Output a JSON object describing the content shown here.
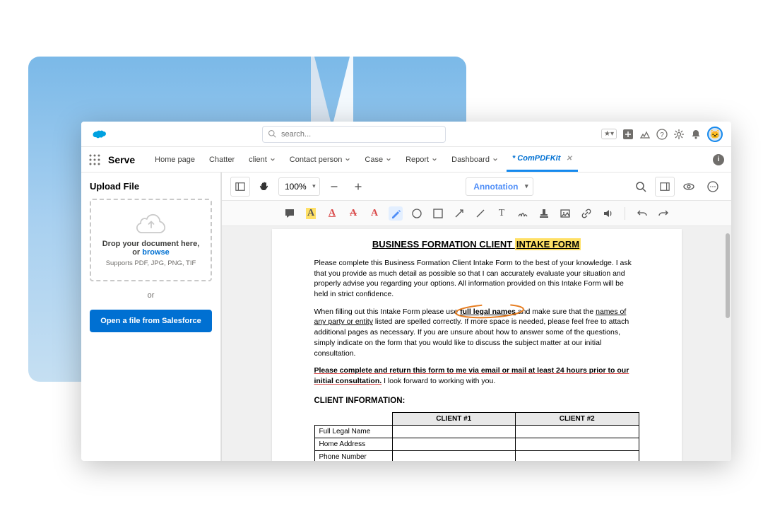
{
  "header": {
    "search_placeholder": "search...",
    "star_combo": "★▾"
  },
  "nav": {
    "app_name": "Serve",
    "tabs": [
      {
        "label": "Home page",
        "has_menu": false
      },
      {
        "label": "Chatter",
        "has_menu": false
      },
      {
        "label": "client",
        "has_menu": true
      },
      {
        "label": "Contact person",
        "has_menu": true
      },
      {
        "label": "Case",
        "has_menu": true
      },
      {
        "label": "Report",
        "has_menu": true
      },
      {
        "label": "Dashboard",
        "has_menu": true
      }
    ],
    "active_tab": "* ComPDFKit"
  },
  "upload": {
    "title": "Upload File",
    "drop_line1": "Drop your document here,",
    "drop_line2_a": "or ",
    "drop_line2_b": "browse",
    "supports": "Supports PDF, JPG, PNG, TIF",
    "or": "or",
    "button": "Open a file from Salesforce"
  },
  "viewer": {
    "zoom": "100%",
    "mode": "Annotation"
  },
  "doc": {
    "title_a": "BUSINESS FORMATION CLIENT ",
    "title_b": "INTAKE FORM",
    "p1": "Please complete this Business Formation Client Intake Form to the best of your knowledge. I ask that you provide as much detail as possible so that I can accurately evaluate your situation and properly advise you regarding your options. All information provided on this Intake Form will be held in strict confidence.",
    "p2_a": "When filling out this Intake Form please use ",
    "p2_b": "full legal names",
    "p2_c": " and make sure that the ",
    "p2_d": "names of any party or entity",
    "p2_e": " listed are spelled correctly. If more space is needed, please feel free to attach additional pages as necessary. If you are unsure about how to answer some of the questions, simply indicate on the form that you would like to discuss the subject matter at our initial consultation.",
    "p3_a": "Please complete and return this form to me via email or mail at least ",
    "p3_b": "24 hours prior to our initial consultation.",
    "p3_c": " I look forward to working with you.",
    "section": "CLIENT INFORMATION:",
    "table": {
      "h1": "CLIENT #1",
      "h2": "CLIENT #2",
      "rows": [
        "Full Legal Name",
        "Home Address",
        "Phone Number"
      ]
    }
  }
}
